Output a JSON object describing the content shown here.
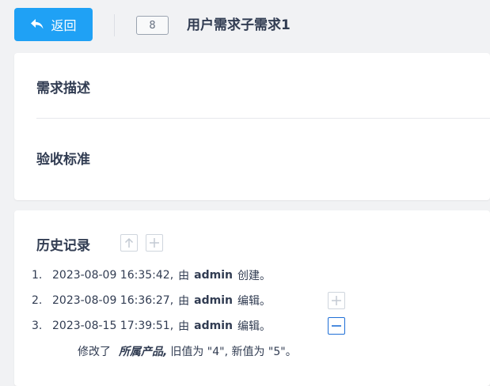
{
  "header": {
    "back_label": "返回",
    "story_id": "8",
    "story_title": "用户需求子需求1"
  },
  "description_panel": {
    "description_title": "需求描述",
    "acceptance_title": "验收标准"
  },
  "history": {
    "title": "历史记录",
    "entries": [
      {
        "num": "1.",
        "datetime": "2023-08-09 16:35:42,",
        "by": "由",
        "actor": "admin",
        "action": "创建。"
      },
      {
        "num": "2.",
        "datetime": "2023-08-09 16:36:27,",
        "by": "由",
        "actor": "admin",
        "action": "编辑。"
      },
      {
        "num": "3.",
        "datetime": "2023-08-15 17:39:51,",
        "by": "由",
        "actor": "admin",
        "action": "编辑。"
      }
    ],
    "change": {
      "prefix": "修改了",
      "field": "所属产品,",
      "detail": "旧值为 \"4\", 新值为 \"5\"。"
    }
  },
  "colors": {
    "accent": "#1fa1f5",
    "background": "#f1f2f4",
    "active_border": "#1f6fd6"
  }
}
